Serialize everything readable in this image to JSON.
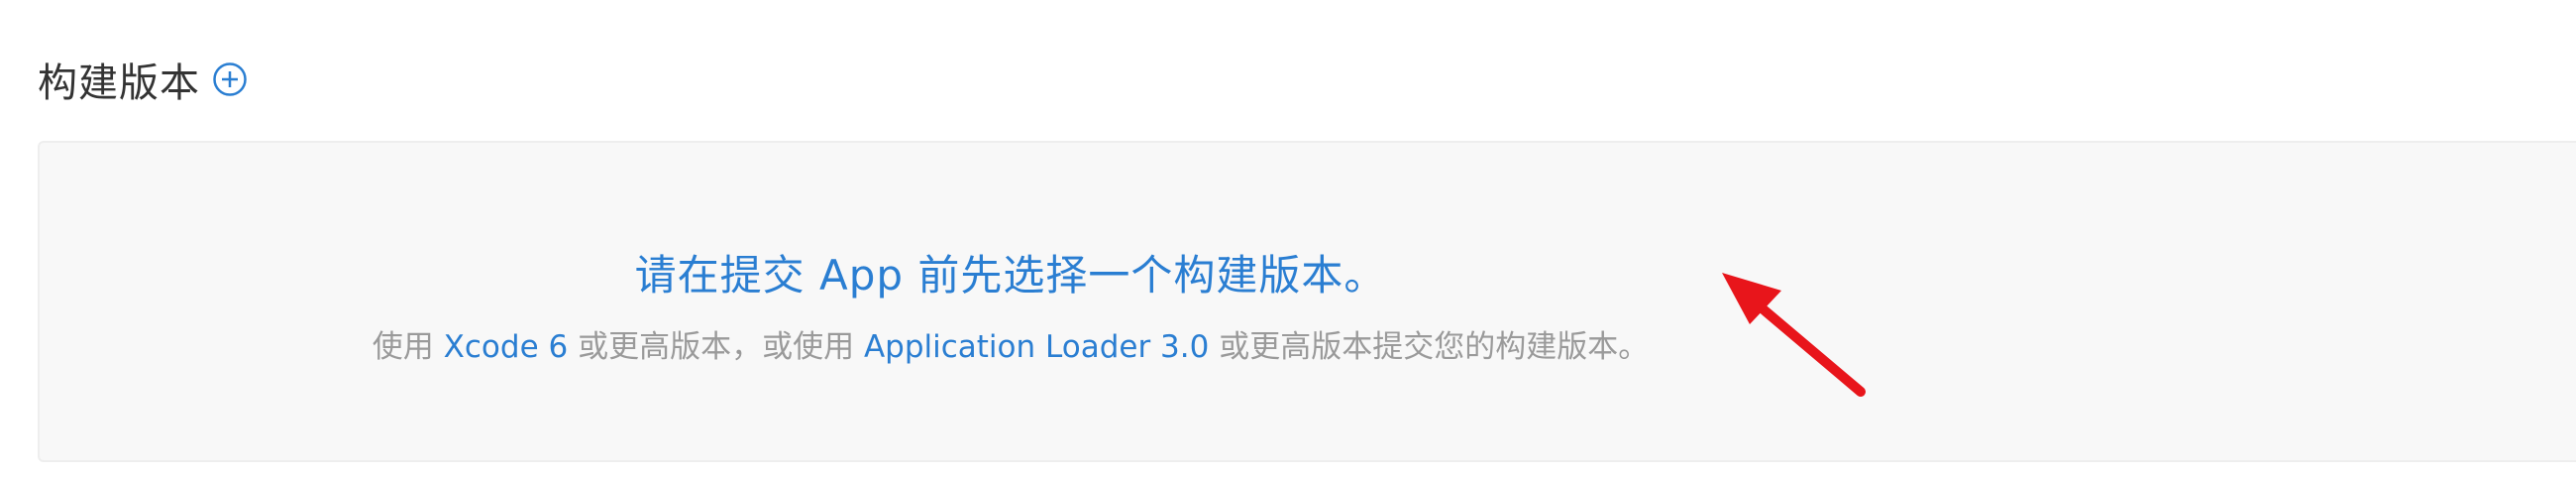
{
  "section": {
    "title": "构建版本",
    "add_icon": "plus-circle-icon"
  },
  "empty_state": {
    "prompt": "请在提交 App 前先选择一个构建版本。",
    "hint": {
      "part1": "使用 ",
      "link1": "Xcode 6",
      "part2": " 或更高版本，或使用 ",
      "link2": "Application Loader 3.0",
      "part3": " 或更高版本提交您的构建版本。"
    }
  },
  "colors": {
    "accent": "#2a7ed2",
    "panel_bg": "#f8f8f8",
    "hint_text": "#9a9a9a",
    "annotation_arrow": "#e8151b"
  },
  "annotation": {
    "icon": "red-arrow-icon"
  }
}
